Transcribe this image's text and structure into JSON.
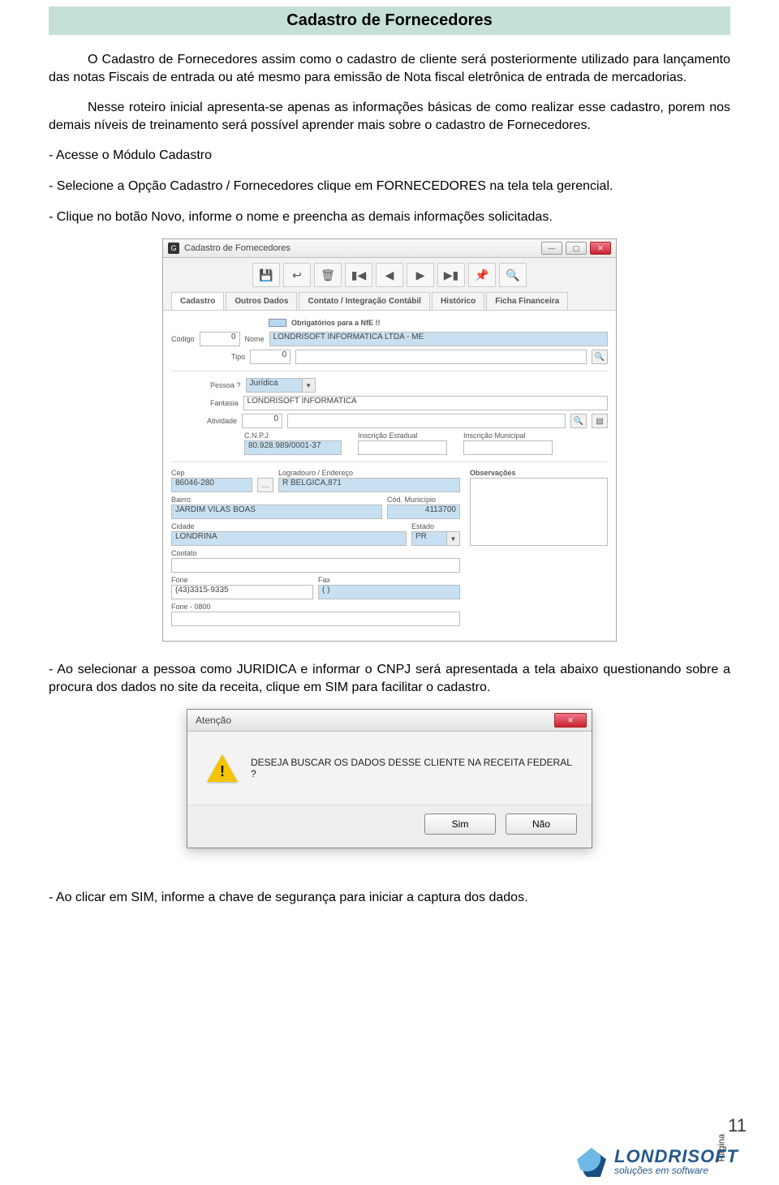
{
  "page": {
    "title": "Cadastro de Fornecedores",
    "p1": "O Cadastro de Fornecedores assim como o cadastro de cliente será posteriormente utilizado para lançamento das notas Fiscais de entrada ou até mesmo para emissão de Nota fiscal eletrônica de entrada de mercadorias.",
    "p2": "Nesse roteiro inicial apresenta-se apenas as informações básicas de como realizar esse cadastro, porem nos demais níveis de treinamento será possível aprender mais sobre o cadastro de Fornecedores.",
    "p3": "- Acesse o Módulo Cadastro",
    "p4": "- Selecione a Opção Cadastro / Fornecedores clique em FORNECEDORES na tela tela gerencial.",
    "p5": "- Clique no botão Novo, informe o nome e preencha as demais informações solicitadas.",
    "p6": "- Ao selecionar a pessoa como JURIDICA e informar o CNPJ será apresentada a tela abaixo questionando sobre a procura dos dados no site da receita, clique em SIM para facilitar o cadastro.",
    "p7": "- Ao clicar em SIM, informe a chave de segurança para iniciar a captura dos dados.",
    "page_label": "Página",
    "page_number": "11"
  },
  "brand": {
    "name": "LONDRISOFT",
    "tagline": "soluções em software"
  },
  "form": {
    "window_title": "Cadastro de Fornecedores",
    "tabs": [
      "Cadastro",
      "Outros Dados",
      "Contato / Integração Contábil",
      "Histórico",
      "Ficha Financeira"
    ],
    "hint": "Obrigatórios para a NfE !!",
    "labels": {
      "codigo": "Código",
      "nome": "Nome",
      "tipo": "Tipo",
      "pessoa": "Pessoa ?",
      "fantasia": "Fantasia",
      "atividade": "Atividade",
      "cnpj": "C.N.P.J",
      "ie": "Inscrição Estadual",
      "im": "Inscrição Municipal",
      "cep": "Cep",
      "logradouro": "Logradouro / Endereço",
      "bairro": "Bairro",
      "cod_mun": "Cód. Município",
      "cidade": "Cidade",
      "estado": "Estado",
      "contato": "Contato",
      "fone": "Fone",
      "fax": "Fax",
      "fone0800": "Fone - 0800",
      "observ": "Observações"
    },
    "values": {
      "codigo": "0",
      "nome": "LONDRISOFT INFORMATICA LTDA - ME",
      "tipo": "0",
      "pessoa": "Jurídica",
      "fantasia": "LONDRISOFT INFORMATICA",
      "atividade": "0",
      "cnpj": "80.928.989/0001-37",
      "ie": "",
      "im": "",
      "cep": "86046-280",
      "logradouro": "R BELGICA,871",
      "bairro": "JARDIM VILAS BOAS",
      "cod_mun": "4113700",
      "cidade": "LONDRINA",
      "estado": "PR",
      "contato": "",
      "fone": "(43)3315-9335",
      "fax": "(  )",
      "fone0800": ""
    }
  },
  "dialog": {
    "title": "Atenção",
    "message": "DESEJA BUSCAR OS DADOS DESSE CLIENTE NA RECEITA FEDERAL ?",
    "yes": "Sim",
    "no": "Não"
  }
}
